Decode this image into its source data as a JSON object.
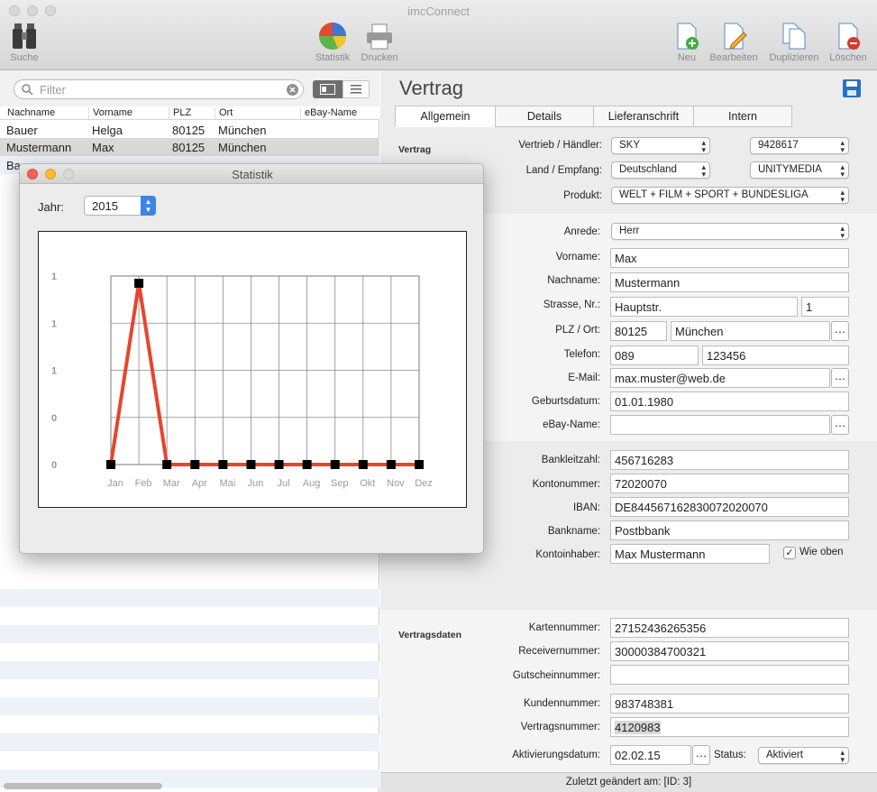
{
  "window": {
    "title": "imcConnect"
  },
  "toolbar": {
    "search_label": "Suche",
    "stats_label": "Statistik",
    "print_label": "Drucken",
    "new_label": "Neu",
    "edit_label": "Bearbeiten",
    "duplicate_label": "Duplizieren",
    "delete_label": "Löschen"
  },
  "list": {
    "filter_placeholder": "Filter",
    "columns": [
      "Nachname",
      "Vorname",
      "PLZ",
      "Ort",
      "eBay-Name"
    ],
    "rows": [
      {
        "nachname": "Bauer",
        "vorname": "Helga",
        "plz": "80125",
        "ort": "München"
      },
      {
        "nachname": "Mustermann",
        "vorname": "Max",
        "plz": "80125",
        "ort": "München"
      },
      {
        "nachname": "Ba",
        "vorname": "",
        "plz": "",
        "ort": ""
      }
    ]
  },
  "detail": {
    "title": "Vertrag",
    "tabs": [
      "Allgemein",
      "Details",
      "Lieferanschrift",
      "Intern"
    ],
    "vertrag": {
      "section_label": "Vertrag",
      "vertrieb_label": "Vertrieb / Händler:",
      "vertrieb_value": "SKY",
      "vertrieb_code": "9428617",
      "land_label": "Land / Empfang:",
      "land_value": "Deutschland",
      "empfang_value": "UNITYMEDIA",
      "produkt_label": "Produkt:",
      "produkt_value": "WELT + FILM + SPORT + BUNDESLIGA"
    },
    "person": {
      "anrede_label": "Anrede:",
      "anrede_value": "Herr",
      "vorname_label": "Vorname:",
      "vorname_value": "Max",
      "nachname_label": "Nachname:",
      "nachname_value": "Mustermann",
      "strasse_label": "Strasse, Nr.:",
      "strasse_value": "Hauptstr.",
      "nr_value": "1",
      "plz_label": "PLZ / Ort:",
      "plz_value": "80125",
      "ort_value": "München",
      "telefon_label": "Telefon:",
      "vorwahl_value": "089",
      "telefon_value": "123456",
      "email_label": "E-Mail:",
      "email_value": "max.muster@web.de",
      "geburt_label": "Geburtsdatum:",
      "geburt_value": "01.01.1980",
      "ebay_label": "eBay-Name:",
      "ebay_value": ""
    },
    "bank": {
      "blz_label": "Bankleitzahl:",
      "blz_value": "456716283",
      "konto_label": "Kontonummer:",
      "konto_value": "72020070",
      "iban_label": "IBAN:",
      "iban_value": "DE844567162830072020070",
      "bankname_label": "Bankname:",
      "bankname_value": "Postbbank",
      "inhaber_label": "Kontoinhaber:",
      "inhaber_value": "Max Mustermann",
      "wie_oben_label": "Wie oben",
      "wie_oben_checked": true
    },
    "vertragsdaten": {
      "section_label": "Vertragsdaten",
      "karten_label": "Kartennummer:",
      "karten_value": "27152436265356",
      "receiver_label": "Receivernummer:",
      "receiver_value": "30000384700321",
      "gutschein_label": "Gutscheinnummer:",
      "gutschein_value": "",
      "kunden_label": "Kundennummer:",
      "kunden_value": "983748381",
      "vertrags_label": "Vertragsnummer:",
      "vertrags_value": "4120983",
      "aktiv_label": "Aktivierungsdatum:",
      "aktiv_value": "02.02.15",
      "status_label": "Status:",
      "status_value": "Aktiviert"
    },
    "footer": "Zuletzt geändert am:  [ID: 3]"
  },
  "statistik": {
    "title": "Statistik",
    "year_label": "Jahr:",
    "year_value": "2015"
  },
  "chart_data": {
    "type": "line",
    "categories": [
      "Jan",
      "Feb",
      "Mar",
      "Apr",
      "Mai",
      "Jun",
      "Jul",
      "Aug",
      "Sep",
      "Okt",
      "Nov",
      "Dez"
    ],
    "values": [
      0,
      1,
      0,
      0,
      0,
      0,
      0,
      0,
      0,
      0,
      0,
      0
    ],
    "y_tick_labels": [
      "1",
      "1",
      "1",
      "0",
      "0"
    ],
    "ylim": [
      0,
      1
    ],
    "grid": true,
    "colors": {
      "line": "#e8452c",
      "marker": "#000000"
    }
  },
  "colors": {
    "accent": "#3d84e6",
    "selected_row": "#d9d9d9",
    "stripe": "#edf2f9"
  }
}
